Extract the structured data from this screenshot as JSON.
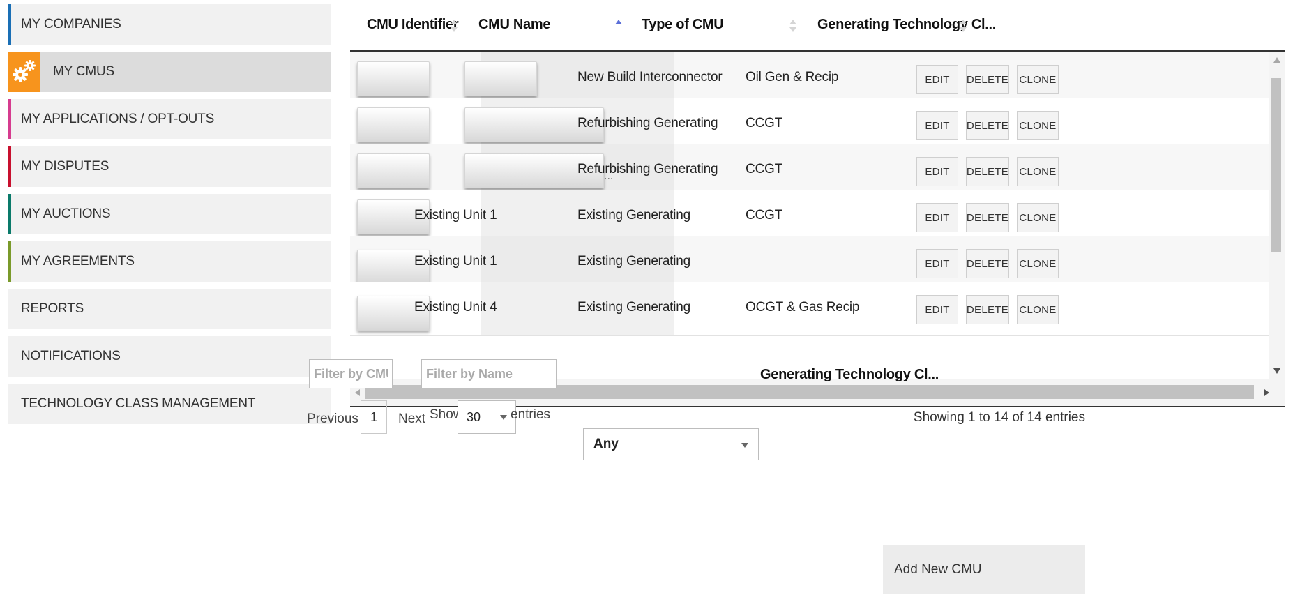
{
  "sidebar": {
    "items": [
      {
        "label": "MY COMPANIES",
        "accent": "#1a6fb5"
      },
      {
        "label": "MY CMUS",
        "accent": "#f7941d",
        "active": true,
        "icon": "gears-icon"
      },
      {
        "label": "MY APPLICATIONS / OPT-OUTS",
        "accent": "#d63c8f"
      },
      {
        "label": "MY DISPUTES",
        "accent": "#c8102e"
      },
      {
        "label": "MY AUCTIONS",
        "accent": "#0a7a6a"
      },
      {
        "label": "MY AGREEMENTS",
        "accent": "#7a9a2a"
      },
      {
        "label": "REPORTS"
      },
      {
        "label": "NOTIFICATIONS"
      },
      {
        "label": "TECHNOLOGY CLASS MANAGEMENT"
      }
    ]
  },
  "table": {
    "columns": [
      {
        "label": "CMU Identifier",
        "sort": "none"
      },
      {
        "label": "CMU Name",
        "sort": "asc"
      },
      {
        "label": "Type of CMU",
        "sort": "none"
      },
      {
        "label": "Generating Technology Cl...",
        "sort": "none"
      }
    ],
    "rows": [
      {
        "id": "",
        "name": "",
        "type": "New Build Interconnector",
        "tech": "Oil Gen & Recip"
      },
      {
        "id": "",
        "name": "",
        "type": "Refurbishing Generating",
        "tech": "CCGT"
      },
      {
        "id": "",
        "name": "",
        "name_suffix": "...",
        "type": "Refurbishing Generating",
        "tech": "CCGT"
      },
      {
        "id": "",
        "name": "Existing Unit 1",
        "type": "Existing Generating",
        "tech": "CCGT"
      },
      {
        "id": "",
        "name": "Existing Unit 1",
        "type": "Existing Generating",
        "tech": ""
      },
      {
        "id": "",
        "name": "Existing Unit 4",
        "type": "Existing Generating",
        "tech": "OCGT & Gas Recip"
      }
    ],
    "actions": {
      "edit": "EDIT",
      "delete": "DELETE",
      "clone": "CLONE"
    }
  },
  "filters": {
    "identifier_placeholder": "Filter by CMU Ide",
    "name_placeholder": "Filter by Name",
    "type_selected": "Any",
    "tech_label": "Generating Technology Cl..."
  },
  "pagination": {
    "previous": "Previous",
    "page": "1",
    "next": "Next",
    "show": "Show",
    "page_length": "30",
    "entries": "entries",
    "info": "Showing 1 to 14 of 14 entries"
  },
  "add_button": "Add New CMU"
}
